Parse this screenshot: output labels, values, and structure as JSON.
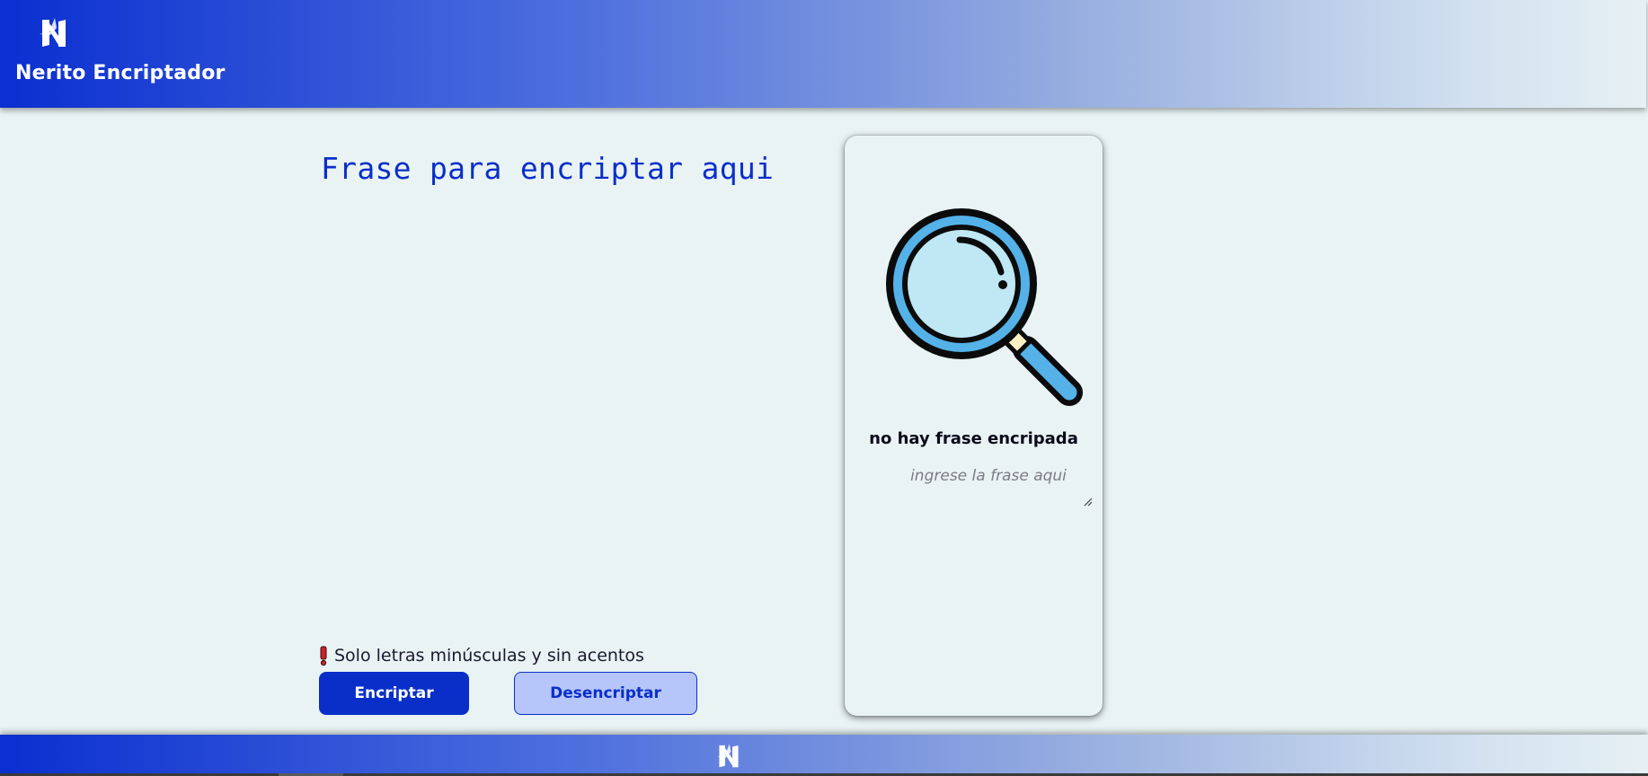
{
  "header": {
    "brand_title": "Nerito Encriptador",
    "logo_icon": "nerito-logo-icon",
    "colors": {
      "gradient_start": "#0b2fd0",
      "gradient_end": "#e6f0f4"
    }
  },
  "main": {
    "input_placeholder": "Frase para encriptar aqui",
    "warning_icon": "exclamation-icon",
    "warning_text": "Solo letras minúsculas y sin acentos",
    "buttons": {
      "encrypt_label": "Encriptar",
      "decrypt_label": "Desencriptar"
    },
    "colors": {
      "accent": "#0a2fc9",
      "secondary_button_bg": "#b6c6fb",
      "page_bg": "#e9f3f3"
    }
  },
  "output_panel": {
    "illustration_icon": "magnifying-glass-icon",
    "empty_title": "no hay frase encripada",
    "output_placeholder": "ingrese la frase aqui"
  },
  "footer": {
    "logo_icon": "nerito-logo-icon"
  }
}
